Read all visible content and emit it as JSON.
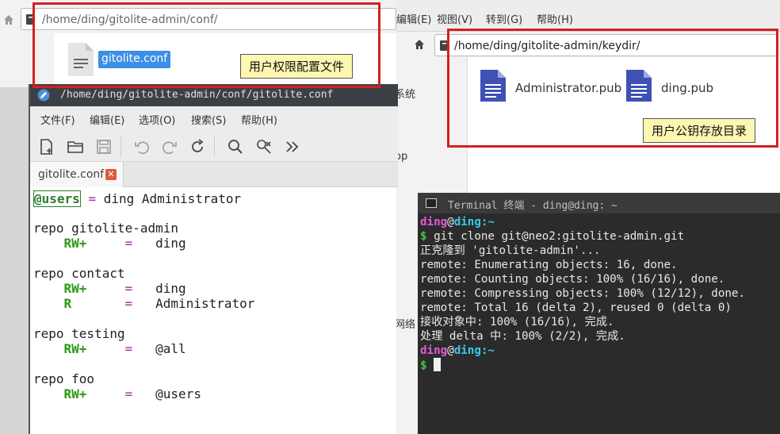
{
  "right_fm": {
    "menu": [
      "编辑(E)",
      "视图(V)",
      "转到(G)",
      "帮助(H)"
    ],
    "path": "/home/ding/gitolite-admin/keydir/",
    "sidebar_fragments": [
      "系统",
      "op",
      "网络"
    ],
    "files": [
      "Administrator.pub",
      "ding.pub"
    ]
  },
  "left_fm": {
    "path": "/home/ding/gitolite-admin/conf/",
    "file": "gitolite.conf"
  },
  "editor": {
    "title": "/home/ding/gitolite-admin/conf/gitolite.conf",
    "menu": [
      "文件(F)",
      "编辑(E)",
      "选项(O)",
      "搜索(S)",
      "帮助(H)"
    ],
    "tab": "gitolite.conf",
    "code": {
      "l1_at": "@users",
      "l1_eq": "=",
      "l1_rest": "ding Administrator",
      "l3": "repo gitolite-admin",
      "l4_perm": "RW+",
      "l4_eq": "=",
      "l4_val": "ding",
      "l6": "repo contact",
      "l7_perm": "RW+",
      "l7_eq": "=",
      "l7_val": "ding",
      "l8_perm": "R",
      "l8_eq": "=",
      "l8_val": "Administrator",
      "l10": "repo testing",
      "l11_perm": "RW+",
      "l11_eq": "=",
      "l11_val": "@all",
      "l13": "repo foo",
      "l14_perm": "RW+",
      "l14_eq": "=",
      "l14_val": "@users"
    }
  },
  "terminal": {
    "title": "Terminal 终端 - ding@ding: ~",
    "user": "ding",
    "at": "@",
    "host": "ding",
    "path_suffix": ":~",
    "dollar": "$",
    "cmd": " git clone git@neo2:gitolite-admin.git",
    "out1": "正克隆到 'gitolite-admin'...",
    "out2": "remote: Enumerating objects: 16, done.",
    "out3": "remote: Counting objects: 100% (16/16), done.",
    "out4": "remote: Compressing objects: 100% (12/12), done.",
    "out5": "remote: Total 16 (delta 2), reused 0 (delta 0)",
    "out6": "接收对象中: 100% (16/16), 完成.",
    "out7": "处理 delta 中: 100% (2/2), 完成."
  },
  "annotations": {
    "conf_label": "用户权限配置文件",
    "keydir_label": "用户公钥存放目录"
  },
  "colors": {
    "highlight_red": "#d42020",
    "callout_bg": "#fdf7b2",
    "selection_blue": "#3d8ee6",
    "doc_icon_blue": "#3f51b5"
  }
}
